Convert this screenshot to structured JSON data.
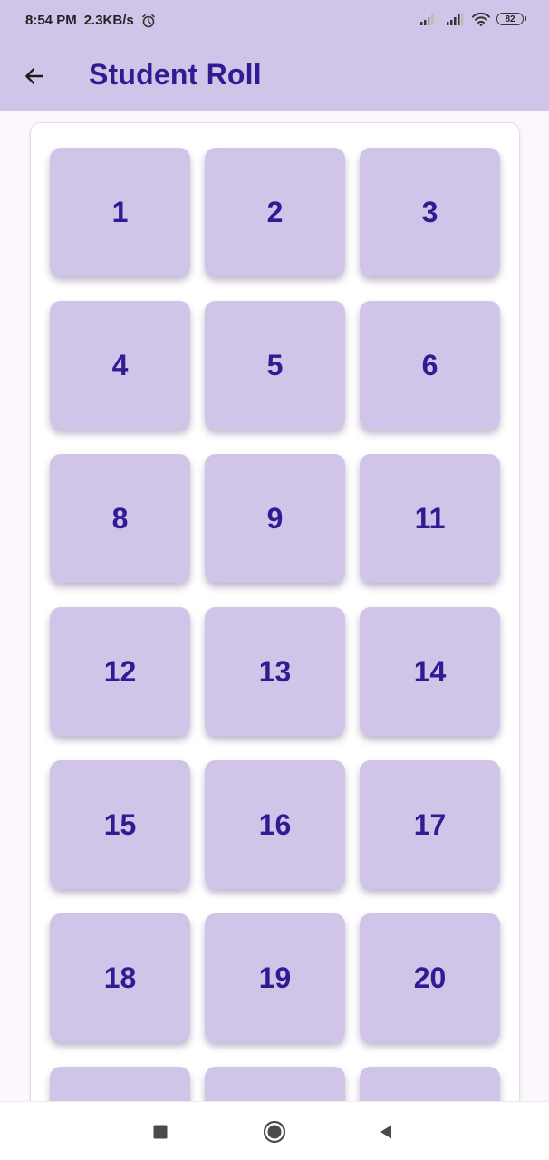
{
  "status_bar": {
    "time": "8:54 PM",
    "net_speed": "2.3KB/s",
    "alarm_icon": "alarm-clock-icon",
    "signal_icons": [
      "signal-icon",
      "signal-icon"
    ],
    "wifi_icon": "wifi-icon",
    "battery": "82"
  },
  "app_bar": {
    "back_icon": "arrow-back-icon",
    "title": "Student Roll"
  },
  "roll_numbers": [
    "1",
    "2",
    "3",
    "4",
    "5",
    "6",
    "8",
    "9",
    "11",
    "12",
    "13",
    "14",
    "15",
    "16",
    "17",
    "18",
    "19",
    "20",
    "",
    "",
    ""
  ],
  "nav_bar": {
    "recents_icon": "square-icon",
    "home_icon": "circle-icon",
    "back_icon": "triangle-back-icon"
  },
  "colors": {
    "header_bg": "#d0c5e8",
    "accent_text": "#311b92",
    "page_bg": "#fcf7fd"
  }
}
